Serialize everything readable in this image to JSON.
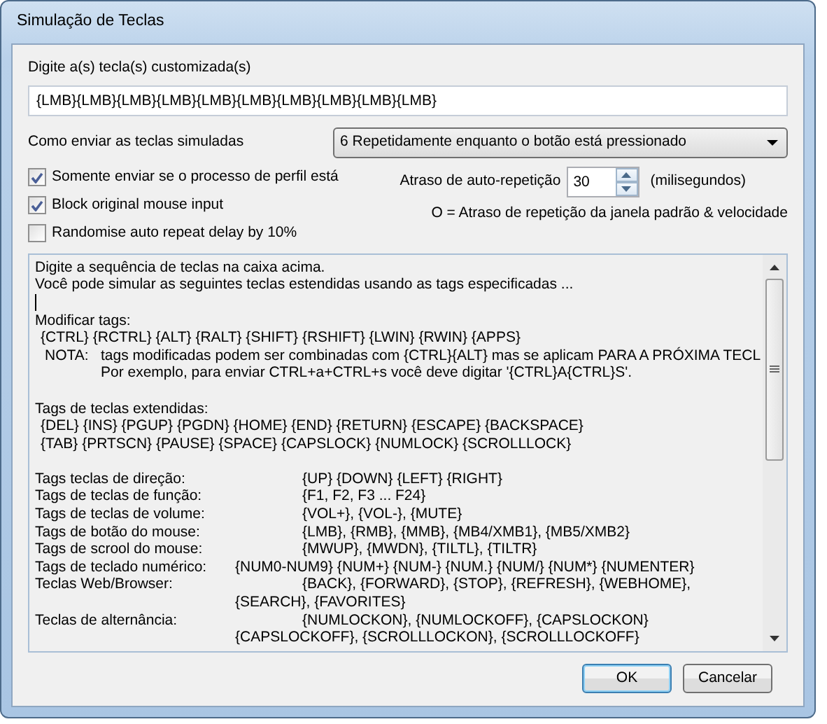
{
  "window": {
    "title": "Simulação de Teclas"
  },
  "custom_keys": {
    "label": "Digite a(s) tecla(s) customizada(s)",
    "value": "{LMB}{LMB}{LMB}{LMB}{LMB}{LMB}{LMB}{LMB}{LMB}{LMB}"
  },
  "send_mode": {
    "label": "Como enviar as teclas simuladas",
    "value": "6 Repetidamente enquanto o botão está pressionado"
  },
  "checkboxes": [
    {
      "label": "Somente enviar se o processo de perfil está",
      "checked": true
    },
    {
      "label": "Block original mouse input",
      "checked": true
    },
    {
      "label": "Randomise auto repeat delay by 10%",
      "checked": false
    }
  ],
  "repeat_delay": {
    "label": "Atraso de auto-repetição",
    "value": "30",
    "unit": "(milisegundos)",
    "hint": "O = Atraso de repetição da janela padrão & velocidade"
  },
  "help_lines": [
    {
      "kind": "text",
      "text": "Digite a sequência de teclas na caixa acima."
    },
    {
      "kind": "text",
      "text": "Você pode simular as seguintes teclas estendidas usando as tags especificadas ..."
    },
    {
      "kind": "cursor"
    },
    {
      "kind": "text",
      "text": "Modificar tags:"
    },
    {
      "kind": "indent",
      "text": "{CTRL} {RCTRL} {ALT} {RALT} {SHIFT} {RSHIFT} {LWIN} {RWIN} {APPS}"
    },
    {
      "kind": "note",
      "label": "NOTA:",
      "text": "tags modificadas podem ser combinadas com {CTRL}{ALT} mas se aplicam PARA A PRÓXIMA TECL"
    },
    {
      "kind": "note-cont",
      "text": "Por exemplo, para enviar CTRL+a+CTRL+s você deve digitar '{CTRL}A{CTRL}S'."
    },
    {
      "kind": "blank"
    },
    {
      "kind": "text",
      "text": "Tags de teclas extendidas:"
    },
    {
      "kind": "indent",
      "text": "{DEL} {INS} {PGUP} {PGDN} {HOME} {END} {RETURN} {ESCAPE} {BACKSPACE}"
    },
    {
      "kind": "indent",
      "text": "{TAB} {PRTSCN} {PAUSE} {SPACE} {CAPSLOCK} {NUMLOCK} {SCROLLLOCK}"
    },
    {
      "kind": "blank"
    },
    {
      "kind": "pair",
      "label": "Tags teclas de direção:",
      "text": "{UP} {DOWN} {LEFT} {RIGHT}"
    },
    {
      "kind": "pair",
      "label": "Tags de teclas de função:",
      "text": "{F1, F2, F3 ... F24}"
    },
    {
      "kind": "pair",
      "label": "Tags de teclas de volume:",
      "text": "{VOL+}, {VOL-}, {MUTE}"
    },
    {
      "kind": "pair",
      "label": "Tags de botão do mouse:",
      "text": "{LMB}, {RMB}, {MMB}, {MB4/XMB1}, {MB5/XMB2}"
    },
    {
      "kind": "pair",
      "label": "Tags de scrool do mouse:",
      "text": "{MWUP}, {MWDN}, {TILTL}, {TILTR}"
    },
    {
      "kind": "pair-near",
      "label": "Tags de teclado numérico:",
      "text": "{NUM0-NUM9} {NUM+} {NUM-} {NUM.} {NUM/} {NUM*} {NUMENTER}"
    },
    {
      "kind": "pair",
      "label": "Teclas Web/Browser:",
      "text": "{BACK}, {FORWARD}, {STOP}, {REFRESH}, {WEBHOME},"
    },
    {
      "kind": "wrap",
      "text": "{SEARCH}, {FAVORITES}"
    },
    {
      "kind": "pair",
      "label": "Teclas de alternância:",
      "text": "{NUMLOCKON}, {NUMLOCKOFF}, {CAPSLOCKON}"
    },
    {
      "kind": "wrap",
      "text": "{CAPSLOCKOFF}, {SCROLLLOCKON}, {SCROLLLOCKOFF}"
    }
  ],
  "buttons": [
    {
      "label": "OK",
      "default": true
    },
    {
      "label": "Cancelar",
      "default": false
    }
  ]
}
